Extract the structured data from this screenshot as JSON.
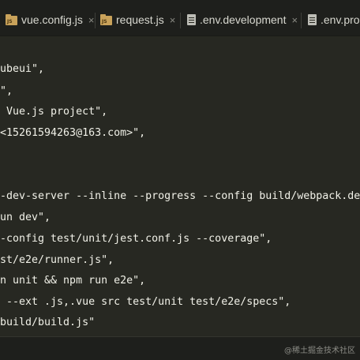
{
  "tabs": [
    {
      "label": "vue.config.js",
      "icon": "js-file-icon",
      "icon_text": "JS"
    },
    {
      "label": "request.js",
      "icon": "js-file-icon",
      "icon_text": "JS"
    },
    {
      "label": ".env.development",
      "icon": "text-file-icon"
    },
    {
      "label": ".env.prod",
      "icon": "text-file-icon"
    }
  ],
  "close_glyph": "×",
  "code_lines": [
    "ubeui\",",
    "\",",
    " Vue.js project\",",
    "<15261594263@163.com>\",",
    "",
    "",
    "-dev-server --inline --progress --config build/webpack.de",
    "un dev\",",
    "-config test/unit/jest.conf.js --coverage\",",
    "st/e2e/runner.js\",",
    "n unit && npm run e2e\",",
    " --ext .js,.vue src test/unit test/e2e/specs\",",
    "build/build.js\""
  ],
  "watermark": "@稀土掘金技术社区",
  "colors": {
    "editor_bg": "#272822",
    "tabbar_bg": "#1e1f1c",
    "text": "#f1f1e8"
  }
}
